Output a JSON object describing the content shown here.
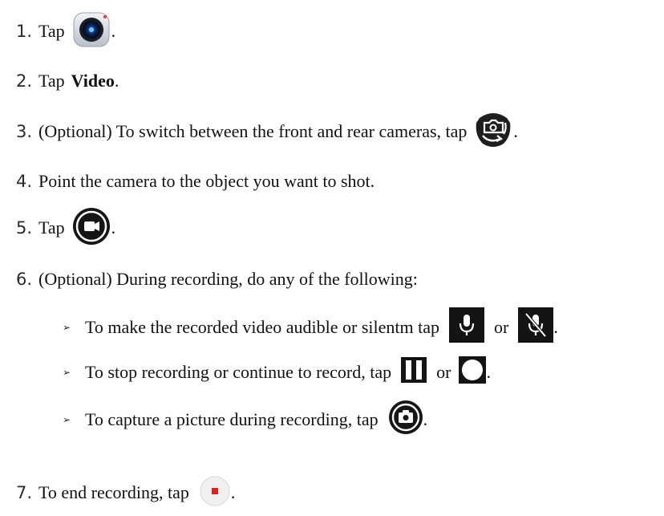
{
  "steps": [
    {
      "num": "1.",
      "pre": "Tap",
      "post": ".",
      "icon": "camera-app-icon"
    },
    {
      "num": "2.",
      "pre": "Tap",
      "bold": "Video",
      "post": "."
    },
    {
      "num": "3.",
      "pre": "(Optional) To switch between the front and rear cameras, tap",
      "post": ".",
      "icon": "switch-camera-icon"
    },
    {
      "num": "4.",
      "pre": "Point the camera to the object you want to shot."
    },
    {
      "num": "5.",
      "pre": "Tap",
      "post": ".",
      "icon": "video-record-icon"
    },
    {
      "num": "6.",
      "pre": "(Optional) During recording, do any of the following:"
    },
    {
      "num": "7.",
      "pre": "To end recording, tap",
      "post": ".",
      "icon": "stop-record-icon"
    }
  ],
  "bullets": [
    {
      "marker": "➢",
      "pre": "To make the recorded video audible or silentm tap",
      "or": "or",
      "post": ".",
      "icons": [
        "microphone-icon",
        "microphone-muted-icon"
      ]
    },
    {
      "marker": "➢",
      "pre": "To stop recording or continue to record, tap",
      "or": "or",
      "post": ".",
      "icons": [
        "pause-icon",
        "resume-icon"
      ]
    },
    {
      "marker": "➢",
      "pre": "To capture a picture during recording, tap",
      "post": ".",
      "icons": [
        "capture-photo-icon"
      ]
    }
  ]
}
